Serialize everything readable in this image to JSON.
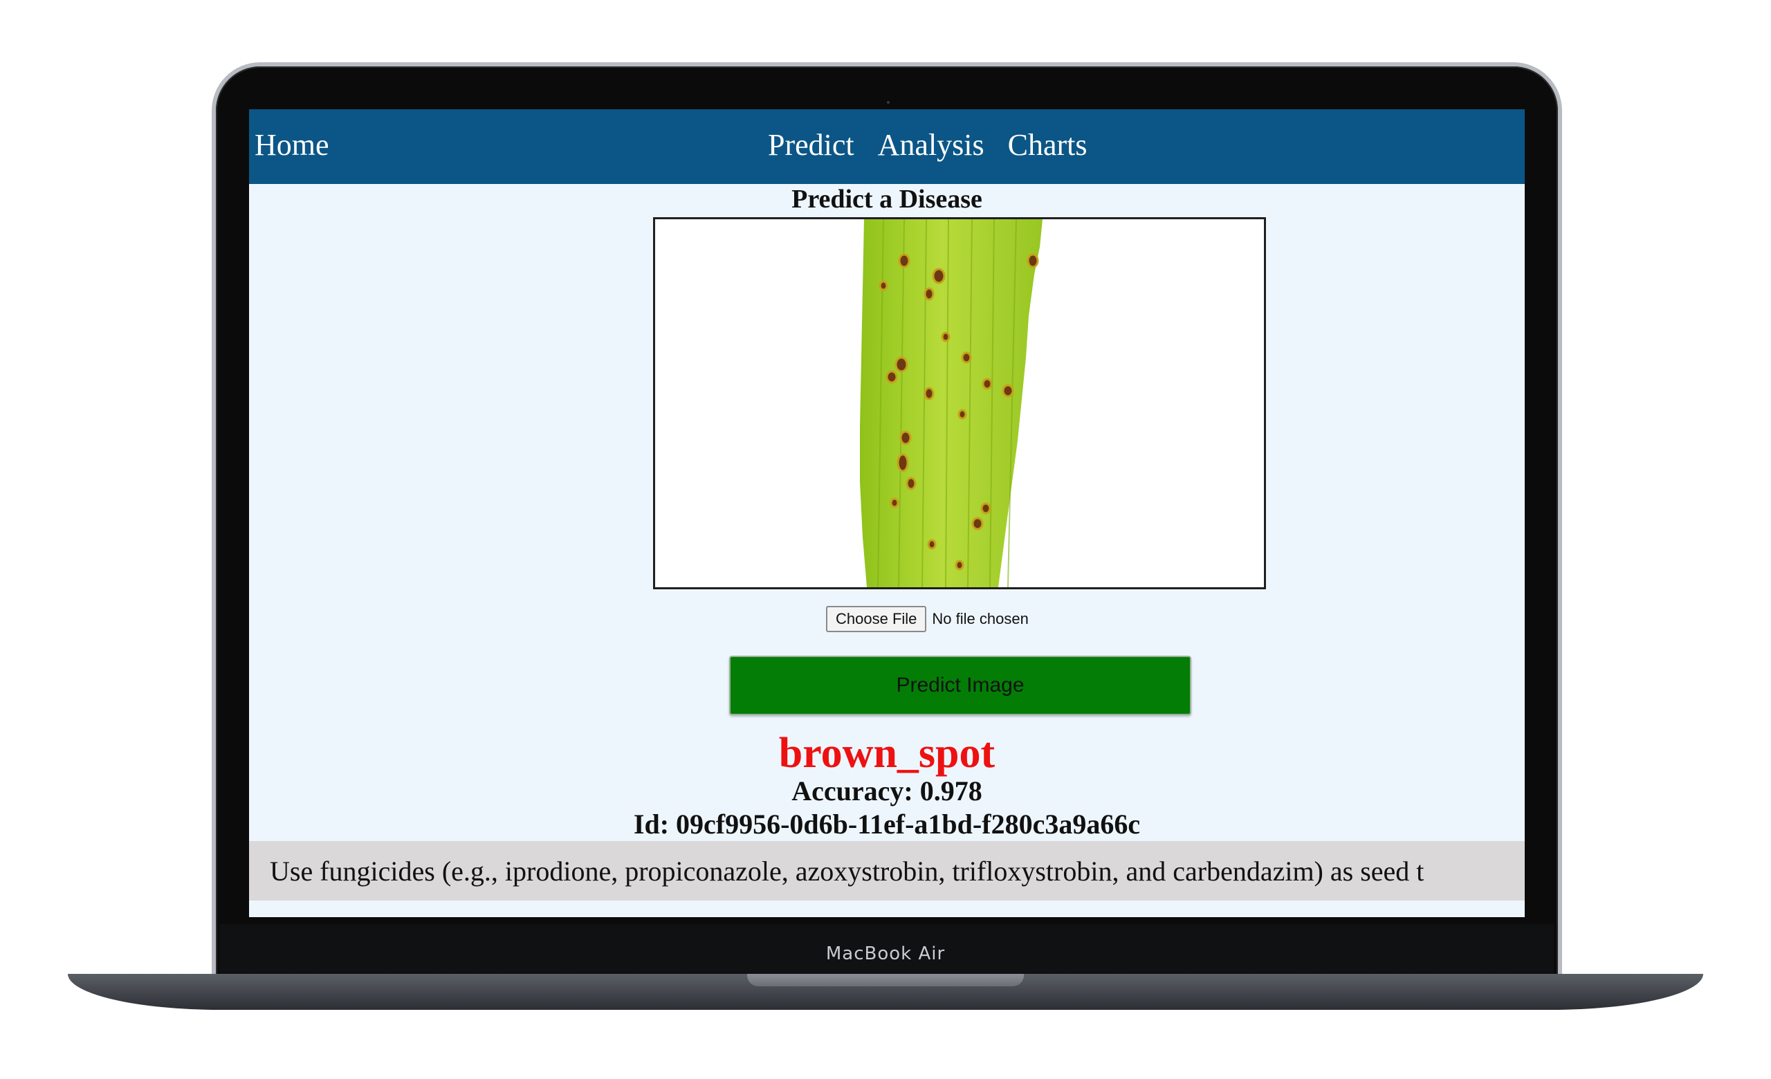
{
  "device": {
    "label": "MacBook Air"
  },
  "nav": {
    "home": "Home",
    "links": [
      "Predict",
      "Analysis",
      "Charts"
    ]
  },
  "page": {
    "title": "Predict a Disease"
  },
  "upload": {
    "choose_label": "Choose File",
    "status": "No file chosen"
  },
  "predict_button": "Predict Image",
  "result": {
    "label": "brown_spot",
    "accuracy": "Accuracy: 0.978",
    "id": "Id: 09cf9956-0d6b-11ef-a1bd-f280c3a9a66c",
    "advice": "Use fungicides (e.g., iprodione, propiconazole, azoxystrobin, trifloxystrobin, and carbendazim) as seed t"
  },
  "colors": {
    "navbar": "#0b5686",
    "page_background": "#eef6fd",
    "predict_button": "#037d06",
    "result_label": "#ee1111",
    "advice_background": "#dad8d8"
  }
}
